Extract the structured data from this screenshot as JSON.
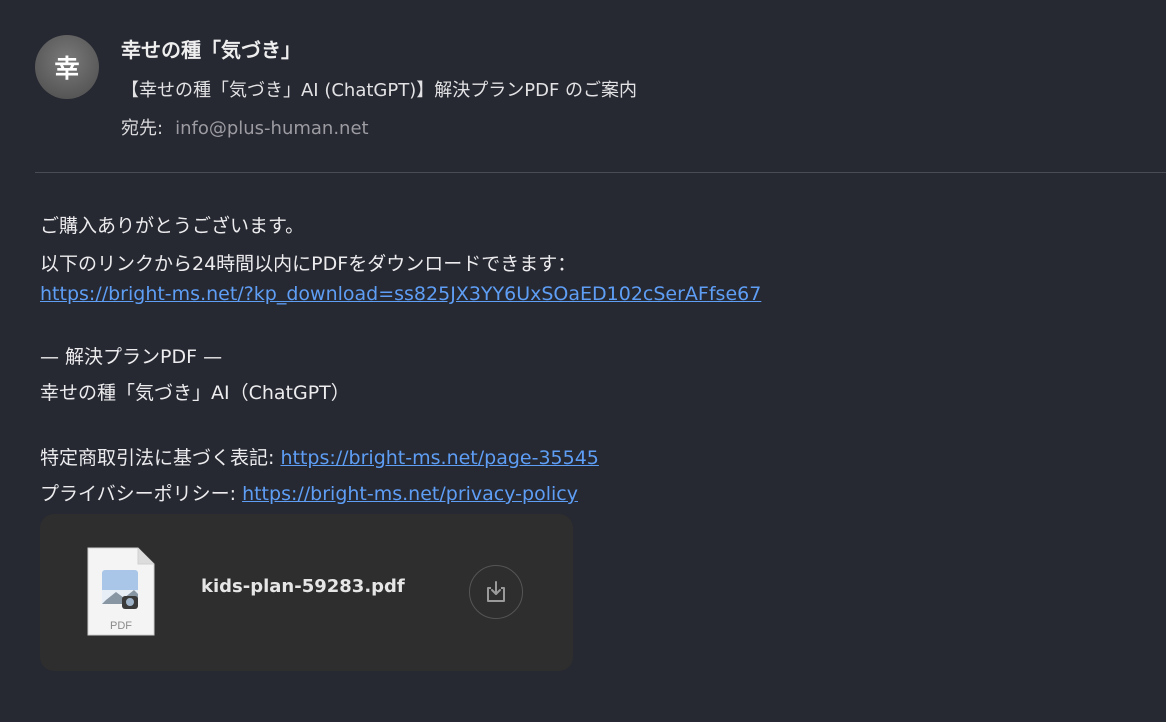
{
  "header": {
    "avatar_char": "幸",
    "sender": "幸せの種「気づき」",
    "subject": "【幸せの種「気づき」AI (ChatGPT)】解決プランPDF のご案内",
    "recipient_label": "宛先:",
    "recipient_value": "info@plus-human.net"
  },
  "body": {
    "line1": "ご購入ありがとうございます。",
    "line2": "以下のリンクから24時間以内にPDFをダウンロードできます：",
    "download_link": "https://bright-ms.net/?kp_download=ss825JX3YY6UxSOaED102cSerAFfse67",
    "plan_heading": "— 解決プランPDF —",
    "plan_name": "幸せの種「気づき」AI（ChatGPT）",
    "legal_label": "特定商取引法に基づく表記: ",
    "legal_link": "https://bright-ms.net/page-35545",
    "privacy_label": "プライバシーポリシー: ",
    "privacy_link": "https://bright-ms.net/privacy-policy"
  },
  "attachment": {
    "file_name": "kids-plan-59283.pdf",
    "file_type_label": "PDF",
    "icon": "pdf-file-icon",
    "action_icon": "download-icon"
  },
  "colors": {
    "background": "#262832",
    "link": "#5e9ef5",
    "card": "#2e2e2e"
  }
}
